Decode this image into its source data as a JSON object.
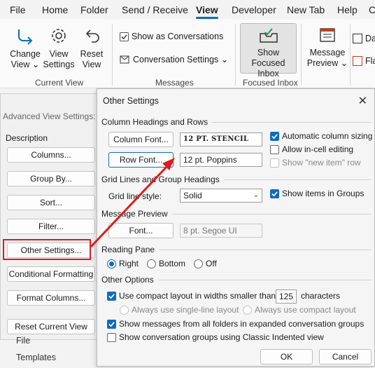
{
  "ribbon_tabs": [
    "File",
    "Home",
    "Folder",
    "Send / Receive",
    "View",
    "Developer",
    "New Tab",
    "Help",
    "C"
  ],
  "ribbon": {
    "change_view": [
      "Change",
      "View ⌄"
    ],
    "view_settings": [
      "View",
      "Settings"
    ],
    "reset_view": [
      "Reset",
      "View"
    ],
    "current_view_label": "Current View",
    "show_as_conversations": "Show as Conversations",
    "conversation_settings": "Conversation Settings ⌄",
    "messages_label": "Messages",
    "show_focused_inbox": [
      "Show",
      "Focused Inbox"
    ],
    "focused_inbox_label": "Focused Inbox",
    "message_preview": [
      "Message",
      "Preview ⌄"
    ],
    "partial_da": "Da",
    "partial_fla": "Fla"
  },
  "adv": {
    "title": "Advanced View Settings: C",
    "description": "Description",
    "buttons": [
      "Columns...",
      "Group By...",
      "Sort...",
      "Filter...",
      "Other Settings...",
      "Conditional Formatting",
      "Format Columns...",
      "Reset Current View"
    ]
  },
  "folders": [
    "File",
    "Templates"
  ],
  "dialog": {
    "title": "Other Settings",
    "close": "✕",
    "sections": {
      "column_headings": "Column Headings and Rows",
      "grid_lines": "Grid Lines and Group Headings",
      "message_preview": "Message Preview",
      "reading_pane": "Reading Pane",
      "other_options": "Other Options"
    },
    "column_font_btn": "Column Font...",
    "column_font_value": "12 PT. STENCIL",
    "row_font_btn": "Row Font...",
    "row_font_value": "12 pt. Poppins",
    "auto_column_sizing": "Automatic column sizing",
    "allow_incell_editing": "Allow in-cell editing",
    "show_new_item_row": "Show \"new item\" row",
    "grid_line_style_label": "Grid line style:",
    "grid_line_style_value": "Solid",
    "show_items_in_groups": "Show items in Groups",
    "preview_font_btn": "Font...",
    "preview_font_value": "8 pt. Segoe UI",
    "reading_right": "Right",
    "reading_bottom": "Bottom",
    "reading_off": "Off",
    "compact_layout": "Use compact layout in widths smaller than",
    "compact_width": "125",
    "characters": "characters",
    "always_single_line": "Always use single-line layout",
    "always_compact": "Always use compact layout",
    "show_all_folders": "Show messages from all folders in expanded conversation groups",
    "classic_indented": "Show conversation groups using Classic Indented view",
    "ok": "OK",
    "cancel": "Cancel"
  },
  "colors": {
    "accent": "#0f6cbd",
    "annotation": "#e01b1b"
  }
}
